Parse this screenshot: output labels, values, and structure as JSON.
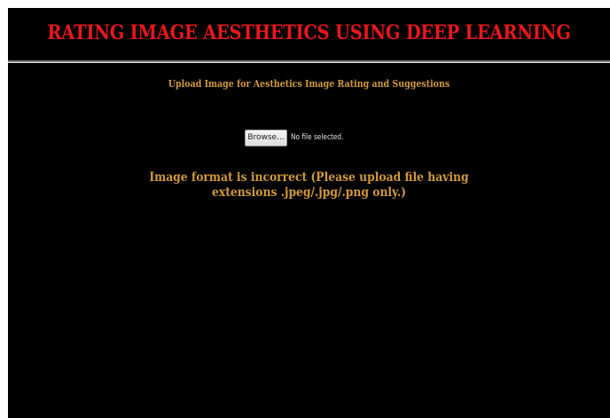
{
  "header": {
    "title": "RATING IMAGE AESTHETICS USING DEEP LEARNING"
  },
  "main": {
    "subtitle": "Upload Image for Aesthetics Image Rating and Suggestions",
    "file_input": {
      "button_label": "Browse...",
      "status_text": "No file selected."
    },
    "error": {
      "line1": "Image format is incorrect (Please upload file having",
      "line2": "extensions .jpeg/.jpg/.png only.)"
    }
  },
  "colors": {
    "background": "#000000",
    "title": "#e8171b",
    "accent_text": "#d29a3a",
    "divider": "#7a7a7a"
  }
}
